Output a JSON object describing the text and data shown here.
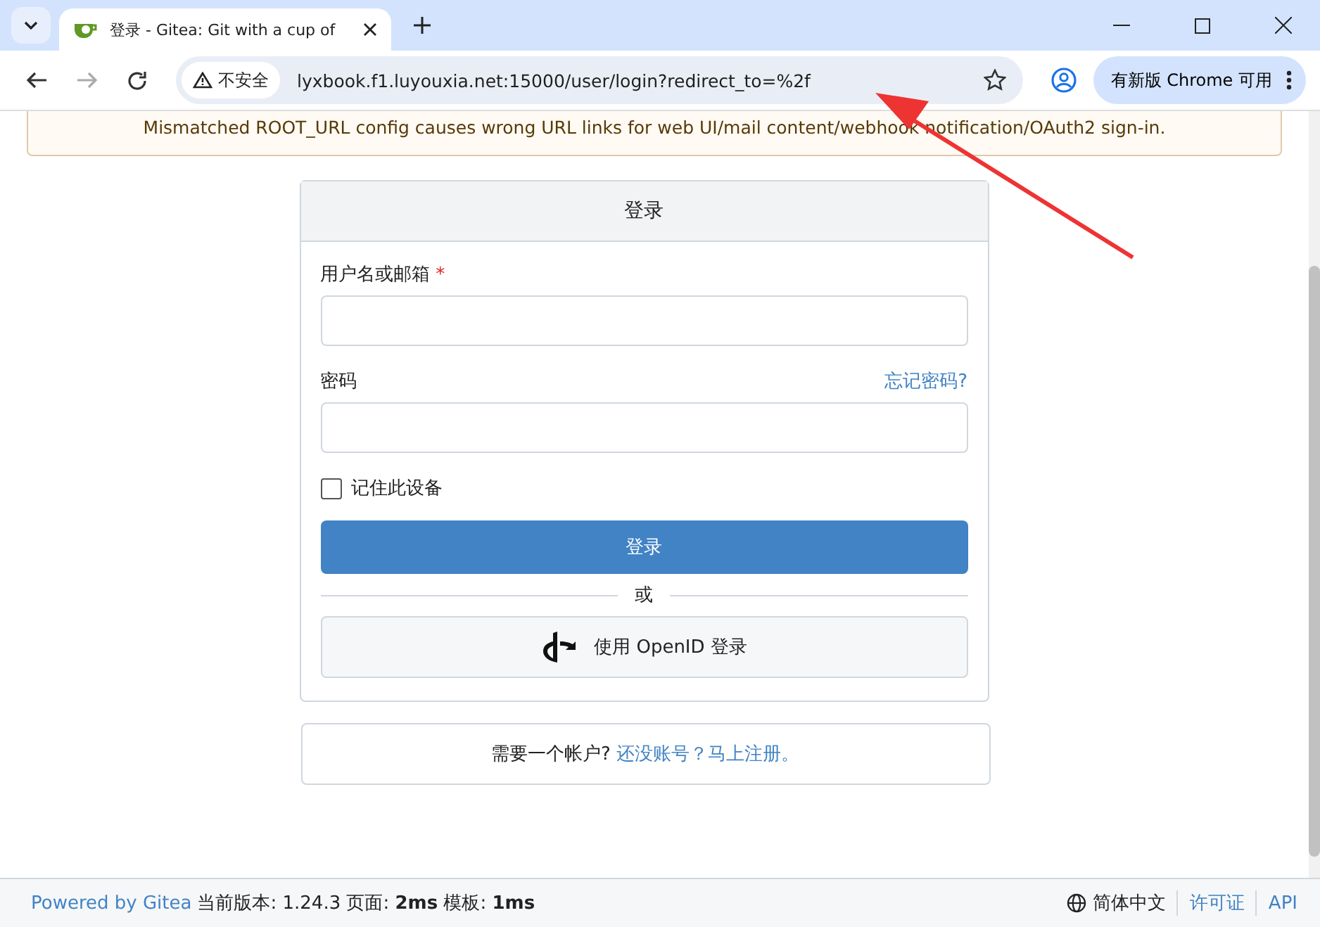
{
  "browser": {
    "tab_title": "登录 - Gitea: Git with a cup of",
    "security_label": "不安全",
    "url": "lyxbook.f1.luyouxia.net:15000/user/login?redirect_to=%2f",
    "update_button": "有新版 Chrome 可用"
  },
  "banner": {
    "text": "Mismatched ROOT_URL config causes wrong URL links for web UI/mail content/webhook notification/OAuth2 sign-in."
  },
  "login_card": {
    "title": "登录",
    "username": {
      "label": "用户名或邮箱",
      "required_mark": "*"
    },
    "password": {
      "label": "密码",
      "forgot_link": "忘记密码?"
    },
    "remember": {
      "label": "记住此设备",
      "checked": false
    },
    "submit_button": "登录",
    "divider_text": "或",
    "openid_button": "使用 OpenID 登录"
  },
  "register_card": {
    "text": "需要一个帐户?",
    "link": "还没账号？马上注册。"
  },
  "footer": {
    "powered_link": "Powered by Gitea",
    "version_text": "当前版本: 1.24.3 页面: **2ms** 模板: **1ms**",
    "language": "简体中文",
    "license_link": "许可证",
    "api_link": "API"
  }
}
